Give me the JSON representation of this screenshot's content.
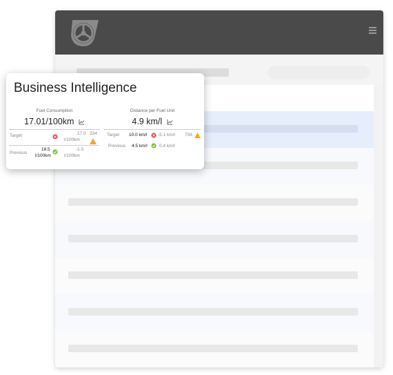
{
  "card": {
    "title": "Business Intelligence",
    "metrics": [
      {
        "label": "Fuel Consumption",
        "value": "17.01/100km",
        "target": {
          "label": "Target",
          "delta": "17.0",
          "delta_unit": "l/100km",
          "count": "334"
        },
        "previous": {
          "label": "Previous",
          "value": "18.5",
          "unit": "l/100km",
          "delta": "-1.5",
          "delta_unit": "l/100km"
        }
      },
      {
        "label": "Distance per Fuel Unit",
        "value": "4.9 km/l",
        "target": {
          "label": "Target",
          "value": "10.0 km/l",
          "delta": "-5.1 km/l",
          "count": "756"
        },
        "previous": {
          "label": "Previous",
          "value": "4.5 km/l",
          "delta": "0.4 km/l"
        }
      }
    ]
  },
  "colors": {
    "header": "#4a4a4a",
    "status_error": "#e2504a",
    "status_ok": "#7cc13b",
    "status_warning": "#f0a830",
    "selected_row": "#e6eefb"
  },
  "icons": {
    "logo": "steering-wheel-logo-icon",
    "menu": "hamburger-menu-icon",
    "trend": "line-chart-icon",
    "error": "x-circle-icon",
    "ok": "check-circle-icon",
    "warning": "warning-triangle-icon"
  }
}
